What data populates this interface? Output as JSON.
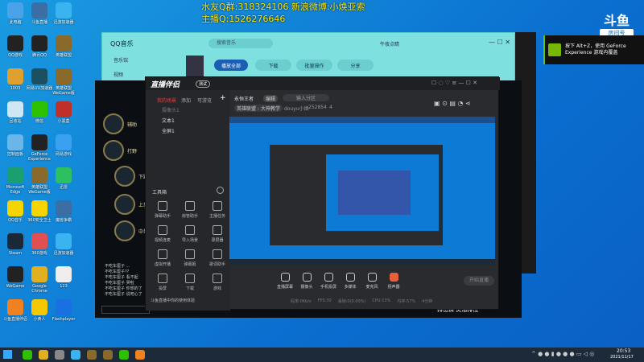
{
  "overlay": {
    "line1": "水友Q群:318324106 新浪微博:小焕亚索",
    "line2": "主播Q:1526276646"
  },
  "douyu_badge": {
    "logo": "斗鱼",
    "room_label": "房间号",
    "room_id": "252854"
  },
  "nvidia_toast": {
    "text": "按下 Alt+Z，使用 GeForce Experience 游戏内覆盖"
  },
  "desktop_icons": [
    {
      "label": "此电脑",
      "color": "#4aa3e8"
    },
    {
      "label": "斗鱼直播",
      "color": "#3a6ea5"
    },
    {
      "label": "迅游加速器",
      "color": "#3ab4f0"
    },
    {
      "label": "QQ游戏",
      "color": "#222"
    },
    {
      "label": "腾讯QQ",
      "color": "#222"
    },
    {
      "label": "英雄联盟",
      "color": "#8a6a2a"
    },
    {
      "label": "1003",
      "color": "#e0a030"
    },
    {
      "label": "网易UU加速器",
      "color": "#1a5060"
    },
    {
      "label": "英雄联盟WeGame版",
      "color": "#8a6a2a"
    },
    {
      "label": "回收站",
      "color": "#cfe6f5"
    },
    {
      "label": "微信",
      "color": "#2dc100"
    },
    {
      "label": "小黑盒",
      "color": "#c0302a"
    },
    {
      "label": "控制面板",
      "color": "#6ab6e8"
    },
    {
      "label": "GeForce Experience",
      "color": "#222"
    },
    {
      "label": "网易游戏",
      "color": "#3aa0f0"
    },
    {
      "label": "Microsoft Edge",
      "color": "#1aa070"
    },
    {
      "label": "英雄联盟WeGame版",
      "color": "#8a6a2a"
    },
    {
      "label": "迅雷",
      "color": "#2cc060"
    },
    {
      "label": "QQ音乐",
      "color": "#f5d400"
    },
    {
      "label": "360安全卫士",
      "color": "#f5d400"
    },
    {
      "label": "魔兽争霸",
      "color": "#3a6ea5"
    },
    {
      "label": "Steam",
      "color": "#1b2838"
    },
    {
      "label": "360游戏",
      "color": "#e05050"
    },
    {
      "label": "迅游加速器",
      "color": "#3ab4f0"
    },
    {
      "label": "WeGame",
      "color": "#222"
    },
    {
      "label": "Google Chrome",
      "color": "#e0b020"
    },
    {
      "label": "123",
      "color": "#eee"
    },
    {
      "label": "斗鱼直播伴侣",
      "color": "#f08020"
    },
    {
      "label": "小黄人",
      "color": "#f5c800"
    },
    {
      "label": "Flashplayer",
      "color": "#1a70e0"
    }
  ],
  "qqmusic": {
    "title": "QQ音乐",
    "nav": [
      "音乐馆",
      "视频"
    ],
    "search_placeholder": "搜索音乐",
    "user": "午夜点睛",
    "buttons": [
      "播放全部",
      "下载",
      "批量操作",
      "分享"
    ]
  },
  "lol": {
    "roles": [
      "辅助",
      "打野",
      "下路",
      "上单",
      "中单"
    ],
    "chat": [
      "不吃车厘子 ...",
      "不吃车厘子??",
      "不吃车厘子 看不起",
      "不吃车厘子 哭啦",
      "不吃车厘子 你想的了",
      "不吃车厘子 说吧心了"
    ],
    "queue": "排位赛 灵活排位"
  },
  "zbhb": {
    "title": "直播伴侣",
    "version": "测试",
    "tabs": [
      "我的场景",
      "添加",
      "可游览"
    ],
    "sources": [
      "摄像头1",
      "文本1",
      "全屏1"
    ],
    "room_title": "永恒王者",
    "edit": "编辑",
    "category_placeholder": "输入分区",
    "game": "英雄联盟 - 大神教学",
    "streamer": "douyu小焕",
    "room_id": "252854",
    "fans": "4",
    "toolbox": "工具箱",
    "tools": [
      "弹幕助手",
      "房管助手",
      "主播任务",
      "视频连麦",
      "导入场景",
      "录屏器",
      "虚拟开播",
      "弹幕姬",
      "歌词助手",
      "投屏",
      "下载",
      "游戏"
    ],
    "notice": "斗鱼直播中你的使用体验",
    "bottom": [
      "直播屏幕",
      "摄像头",
      "手机投屏",
      "多媒体",
      "麦克风",
      "扬声器"
    ],
    "start": "开始直播",
    "status": [
      "码率:0Kb/s",
      "FPS:30",
      "丢帧:0(0.00%)",
      "CPU:13%",
      "内存:57%",
      "4分钟"
    ]
  },
  "taskbar": {
    "time": "20:53",
    "date": "2021/11/17"
  }
}
